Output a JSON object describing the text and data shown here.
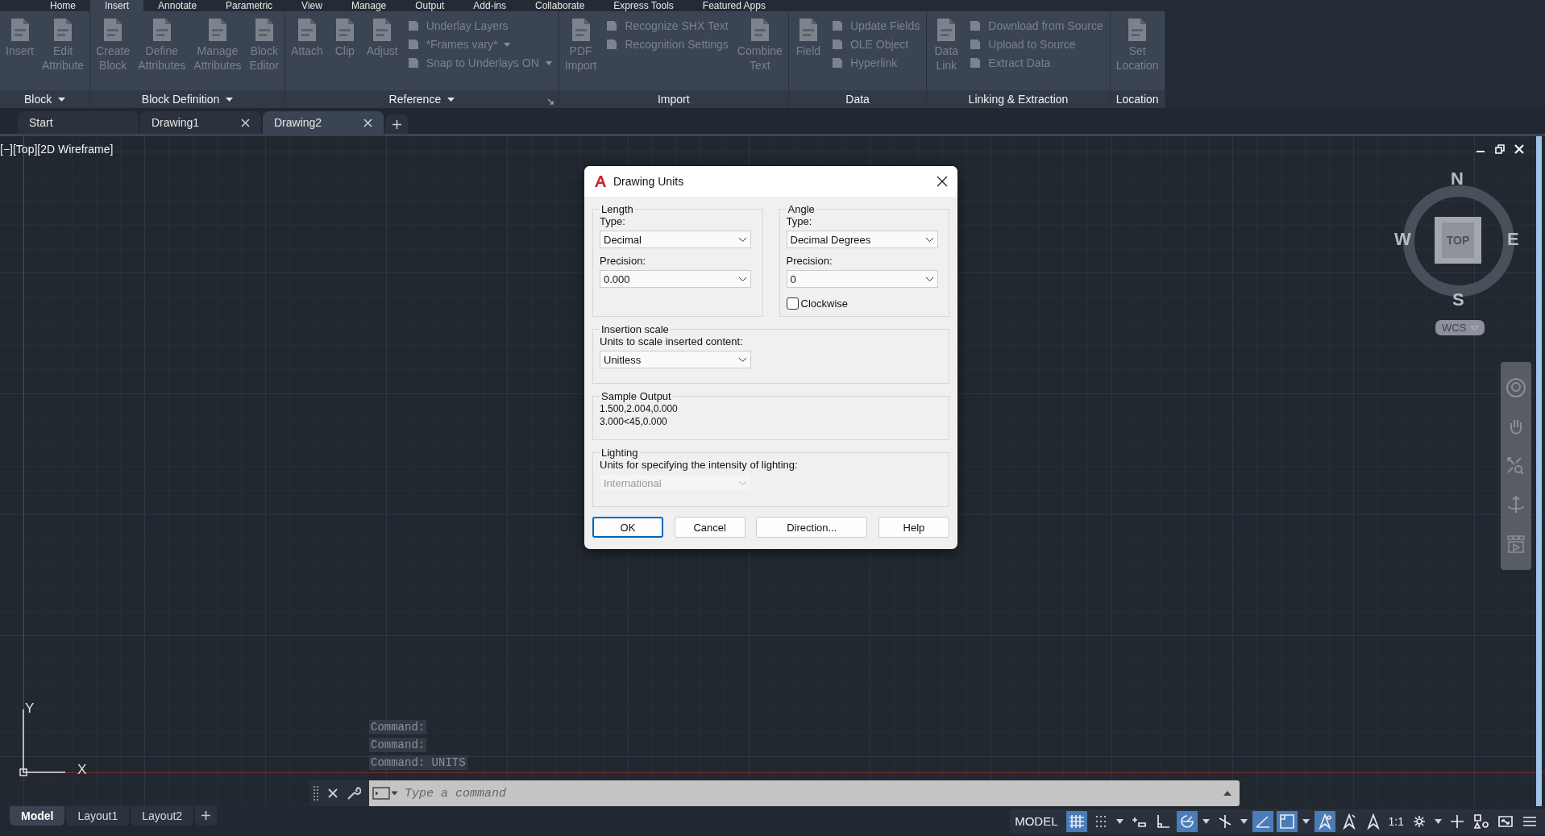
{
  "menu_tabs": [
    {
      "label": "Home",
      "selected": false
    },
    {
      "label": "Insert",
      "selected": true
    },
    {
      "label": "Annotate",
      "selected": false
    },
    {
      "label": "Parametric",
      "selected": false
    },
    {
      "label": "View",
      "selected": false
    },
    {
      "label": "Manage",
      "selected": false
    },
    {
      "label": "Output",
      "selected": false
    },
    {
      "label": "Add-ins",
      "selected": false
    },
    {
      "label": "Collaborate",
      "selected": false
    },
    {
      "label": "Express Tools",
      "selected": false
    },
    {
      "label": "Featured Apps",
      "selected": false
    }
  ],
  "ribbon": [
    {
      "title": "Block",
      "menu": true,
      "launcher": false,
      "tools": [
        {
          "kind": "large",
          "label": "Insert",
          "disabled": true
        },
        {
          "kind": "large",
          "label": "Edit Attribute",
          "disabled": true
        }
      ]
    },
    {
      "title": "Block Definition",
      "menu": true,
      "launcher": false,
      "tools": [
        {
          "kind": "large",
          "label": "Create Block",
          "disabled": true
        },
        {
          "kind": "large",
          "label": "Define Attributes",
          "disabled": true
        },
        {
          "kind": "large",
          "label": "Manage Attributes",
          "disabled": true
        },
        {
          "kind": "large",
          "label": "Block Editor",
          "disabled": true
        }
      ]
    },
    {
      "title": "Reference",
      "menu": true,
      "launcher": true,
      "tools": [
        {
          "kind": "large",
          "label": "Attach",
          "disabled": true
        },
        {
          "kind": "large",
          "label": "Clip",
          "disabled": true
        },
        {
          "kind": "large",
          "label": "Adjust",
          "disabled": true
        },
        {
          "kind": "small",
          "label": "Underlay Layers",
          "disabled": true,
          "dropdown": false
        },
        {
          "kind": "small",
          "label": "*Frames vary*",
          "disabled": true,
          "dropdown": true
        },
        {
          "kind": "small",
          "label": "Snap to Underlays ON",
          "disabled": true,
          "dropdown": true
        }
      ]
    },
    {
      "title": "Import",
      "menu": false,
      "launcher": false,
      "tools": [
        {
          "kind": "large",
          "label": "PDF Import",
          "disabled": true
        },
        {
          "kind": "small",
          "label": "Recognize SHX Text",
          "disabled": true,
          "dropdown": false
        },
        {
          "kind": "small",
          "label": "Recognition Settings",
          "disabled": true,
          "dropdown": false
        },
        {
          "kind": "large",
          "label": "Combine Text",
          "disabled": true
        }
      ]
    },
    {
      "title": "Data",
      "menu": false,
      "launcher": false,
      "tools": [
        {
          "kind": "large",
          "label": "Field",
          "disabled": true
        },
        {
          "kind": "small",
          "label": "Update Fields",
          "disabled": true,
          "dropdown": false
        },
        {
          "kind": "small",
          "label": "OLE Object",
          "disabled": true,
          "dropdown": false
        },
        {
          "kind": "small",
          "label": "Hyperlink",
          "disabled": true,
          "dropdown": false
        }
      ]
    },
    {
      "title": "Linking & Extraction",
      "menu": false,
      "launcher": false,
      "tools": [
        {
          "kind": "large",
          "label": "Data Link",
          "disabled": true
        },
        {
          "kind": "small",
          "label": "Download from Source",
          "disabled": true,
          "dropdown": false
        },
        {
          "kind": "small",
          "label": "Upload to Source",
          "disabled": true,
          "dropdown": false
        },
        {
          "kind": "small",
          "label": "Extract  Data",
          "disabled": true,
          "dropdown": false
        }
      ]
    },
    {
      "title": "Location",
      "menu": false,
      "launcher": false,
      "tools": [
        {
          "kind": "large",
          "label": "Set Location",
          "disabled": true
        }
      ]
    }
  ],
  "doc_tabs": [
    {
      "label": "Start",
      "selected": false,
      "closable": false
    },
    {
      "label": "Drawing1",
      "selected": false,
      "closable": true
    },
    {
      "label": "Drawing2",
      "selected": true,
      "closable": true
    }
  ],
  "viewport": {
    "label": "[−][Top][2D Wireframe]",
    "compass": {
      "n": "N",
      "w": "W",
      "e": "E",
      "s": "S",
      "face": "TOP"
    },
    "ucs_menu": "WCS",
    "ucs": {
      "x": "X",
      "y": "Y"
    }
  },
  "dialog": {
    "title": "Drawing Units",
    "length": {
      "legend": "Length",
      "type_label": "Type:",
      "type_value": "Decimal",
      "precision_label": "Precision:",
      "precision_value": "0.000"
    },
    "angle": {
      "legend": "Angle",
      "type_label": "Type:",
      "type_value": "Decimal Degrees",
      "precision_label": "Precision:",
      "precision_value": "0",
      "clockwise": {
        "label": "Clockwise",
        "checked": false
      }
    },
    "insertion_scale": {
      "legend": "Insertion scale",
      "label": "Units to scale inserted content:",
      "value": "Unitless"
    },
    "sample_output": {
      "legend": "Sample Output",
      "lines": [
        "1.500,2.004,0.000",
        "3.000<45,0.000"
      ]
    },
    "lighting": {
      "legend": "Lighting",
      "label": "Units for specifying the intensity of lighting:",
      "value": "International",
      "disabled": true
    },
    "buttons": [
      {
        "label": "OK",
        "default": true
      },
      {
        "label": "Cancel",
        "default": false
      },
      {
        "label": "Direction...",
        "default": false
      },
      {
        "label": "Help",
        "default": false
      }
    ]
  },
  "command_history": [
    "Command:",
    "Command:",
    "Command: UNITS"
  ],
  "command_line": {
    "placeholder": "Type a command"
  },
  "layout_tabs": [
    {
      "label": "Model",
      "selected": true
    },
    {
      "label": "Layout1",
      "selected": false
    },
    {
      "label": "Layout2",
      "selected": false
    }
  ],
  "status_bar": {
    "space": "MODEL",
    "items": [
      {
        "kind": "grid",
        "on": true
      },
      {
        "kind": "snap",
        "on": false
      },
      {
        "kind": "caret"
      },
      {
        "kind": "infer",
        "on": false
      },
      {
        "kind": "ortho",
        "on": false
      },
      {
        "kind": "polar",
        "on": true
      },
      {
        "kind": "caret"
      },
      {
        "kind": "iso",
        "on": false
      },
      {
        "kind": "caret"
      },
      {
        "kind": "track",
        "on": true
      },
      {
        "kind": "osnap",
        "on": true
      },
      {
        "kind": "caret"
      },
      {
        "kind": "annovis",
        "on": true
      },
      {
        "kind": "autoscale",
        "on": false
      },
      {
        "kind": "annoscale",
        "on": false
      },
      {
        "kind": "scale",
        "label": "1:1"
      },
      {
        "kind": "gear"
      },
      {
        "kind": "caret"
      },
      {
        "kind": "plus"
      },
      {
        "kind": "isolate"
      },
      {
        "kind": "fullscreen"
      },
      {
        "kind": "menu"
      }
    ]
  }
}
